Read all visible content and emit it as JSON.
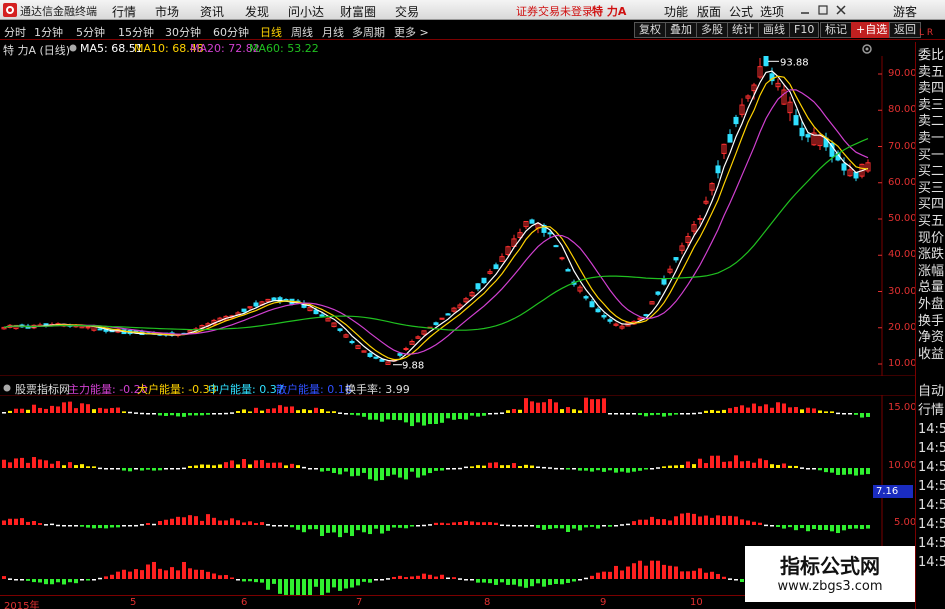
{
  "app": {
    "title": "通达信金融终端",
    "menu": [
      "行情",
      "市场",
      "资讯",
      "发现",
      "问小达",
      "财富圈",
      "交易"
    ],
    "status_warning": "证券交易未登录",
    "stock_name": "特 力A",
    "right_menu": [
      "功能",
      "版面",
      "公式",
      "选项"
    ],
    "guest": "游客"
  },
  "periods": {
    "items": [
      "分时",
      "1分钟",
      "5分钟",
      "15分钟",
      "30分钟",
      "60分钟",
      "日线",
      "周线",
      "月线",
      "多周期",
      "更多 >"
    ],
    "active": "日线"
  },
  "right_buttons": [
    "复权",
    "叠加",
    "多股",
    "统计",
    "画线",
    "F10",
    "标记",
    "+自选",
    "返回"
  ],
  "ma_header": {
    "label": "特 力A (日线)",
    "ma5": "MA5: 68.51",
    "ma10": "MA10: 68.48",
    "ma20": "MA20: 72.82",
    "ma60": "MA60: 53.22",
    "colors": {
      "ma5": "#ffffff",
      "ma10": "#ffd200",
      "ma20": "#d040d0",
      "ma60": "#20c020"
    }
  },
  "price_axis": [
    "90.00",
    "80.00",
    "70.00",
    "60.00",
    "50.00",
    "40.00",
    "30.00",
    "20.00",
    "10.00"
  ],
  "annotations": {
    "high": "93.88",
    "low": "9.88"
  },
  "side_panel": {
    "top_marker": "L R",
    "items": [
      "委比",
      "卖五",
      "卖四",
      "卖三",
      "卖二",
      "卖一",
      "买一",
      "买二",
      "买三",
      "买四",
      "买五",
      "现价",
      "涨跌",
      "涨幅",
      "总量",
      "外盘",
      "换手",
      "净资",
      "收益"
    ],
    "lower_items": [
      "自动",
      "行情",
      "14:5",
      "14:5",
      "14:5",
      "14:5",
      "14:5",
      "14:5",
      "14:5",
      "14:5"
    ]
  },
  "indicator": {
    "name": "股票指标网",
    "zhuli": "主力能量: -0.20",
    "dahu": "大户能量: -0.33",
    "zhonghu": "中户能量: 0.37",
    "sanhu": "散户能量: 0.16",
    "huanshou": "换手率: 3.99",
    "axis": [
      "15.00",
      "10.00",
      "5.00"
    ],
    "value_tag": "7.16"
  },
  "x_axis": [
    "2015年",
    "5",
    "6",
    "7",
    "8",
    "9",
    "10"
  ],
  "watermark": {
    "line1": "指标公式网",
    "line2": "www.zbgs3.com"
  },
  "colors": {
    "up": "#ff3030",
    "down": "#30e0ff",
    "axis": "#e03030",
    "grid": "#7a0000"
  },
  "chart_data": {
    "type": "candlestick",
    "title": "特 力A (日线)",
    "ylim": [
      5,
      98
    ],
    "price_series_by_month": {
      "categories": [
        "2015年",
        "5",
        "6",
        "7",
        "8",
        "9",
        "10"
      ],
      "approx_close": [
        20,
        19,
        27,
        11,
        45,
        20,
        72
      ]
    },
    "high_label": 93.88,
    "low_label": 9.88,
    "ma_last": {
      "MA5": 68.51,
      "MA10": 68.48,
      "MA20": 72.82,
      "MA60": 53.22
    }
  }
}
